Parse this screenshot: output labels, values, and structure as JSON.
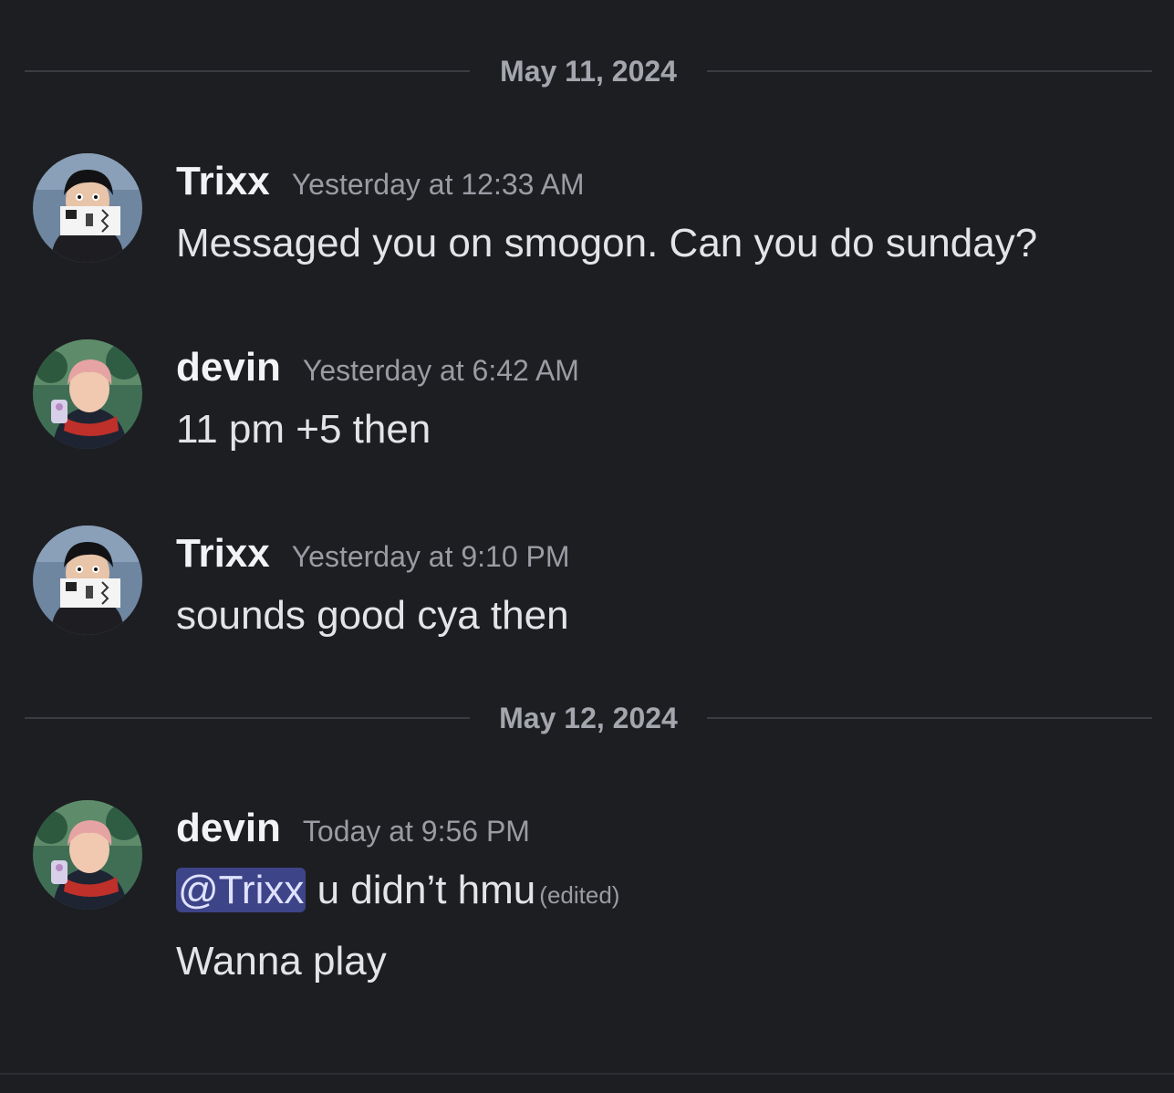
{
  "dividers": [
    {
      "label": "May 11, 2024"
    },
    {
      "label": "May 12, 2024"
    }
  ],
  "messages": [
    {
      "username": "Trixx",
      "timestamp": "Yesterday at 12:33 AM",
      "text": "Messaged you on smogon. Can you do sunday?"
    },
    {
      "username": "devin",
      "timestamp": "Yesterday at 6:42 AM",
      "text": "11 pm +5 then"
    },
    {
      "username": "Trixx",
      "timestamp": "Yesterday at 9:10 PM",
      "text": "sounds good cya then"
    },
    {
      "username": "devin",
      "timestamp": "Today at 9:56 PM",
      "mention": "@Trixx",
      "text": " u didn’t hmu",
      "edited": "(edited)",
      "text2": "Wanna play"
    }
  ],
  "colors": {
    "background": "#1d1e22",
    "mention_bg": "#3e4488",
    "username": "#f2f3f5",
    "timestamp": "#9b9ca3"
  }
}
